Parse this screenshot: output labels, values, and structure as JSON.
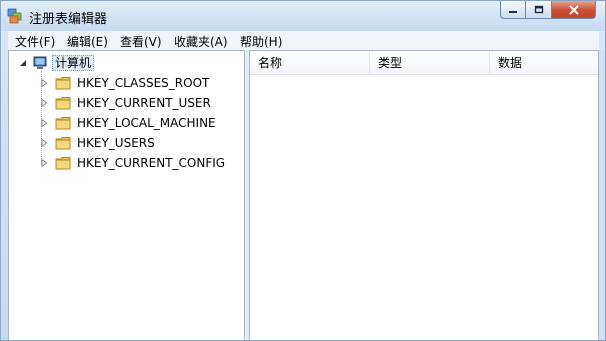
{
  "window": {
    "title": "注册表编辑器"
  },
  "menu": [
    {
      "label": "文件(F)"
    },
    {
      "label": "编辑(E)"
    },
    {
      "label": "查看(V)"
    },
    {
      "label": "收藏夹(A)"
    },
    {
      "label": "帮助(H)"
    }
  ],
  "tree": {
    "root_label": "计算机",
    "items": [
      {
        "label": "HKEY_CLASSES_ROOT"
      },
      {
        "label": "HKEY_CURRENT_USER"
      },
      {
        "label": "HKEY_LOCAL_MACHINE"
      },
      {
        "label": "HKEY_USERS"
      },
      {
        "label": "HKEY_CURRENT_CONFIG"
      }
    ]
  },
  "list": {
    "columns": [
      {
        "label": "名称"
      },
      {
        "label": "类型"
      },
      {
        "label": "数据"
      }
    ]
  },
  "colors": {
    "folder": "#e8c25a",
    "selection": "#dfeaf7",
    "close_button": "#c74d35"
  }
}
